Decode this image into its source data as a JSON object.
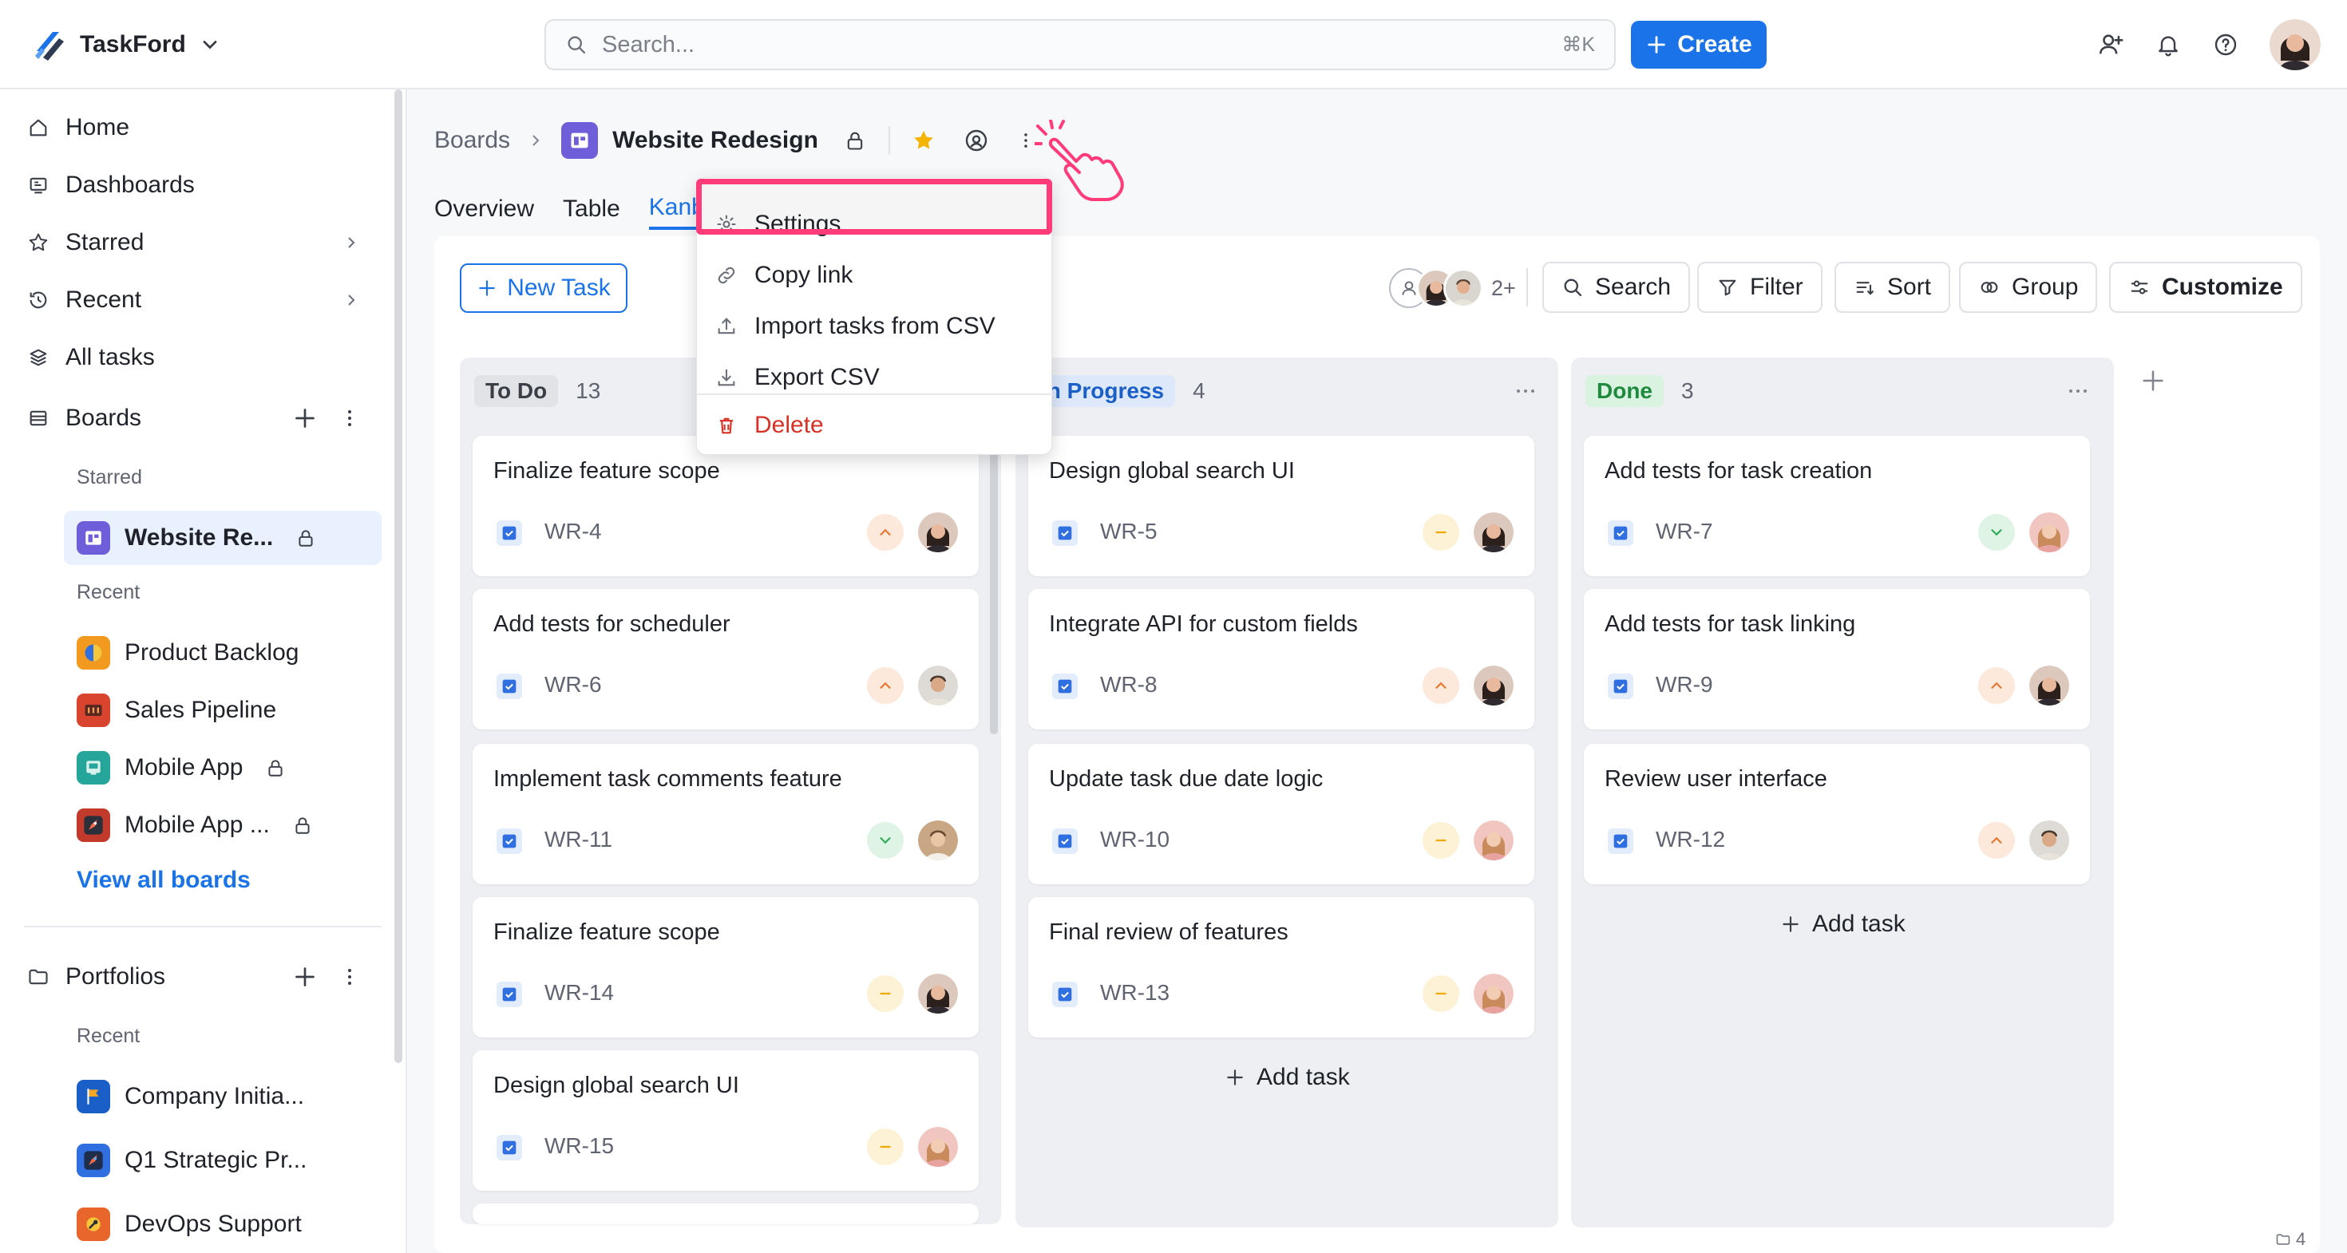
{
  "app": {
    "name": "TaskFord"
  },
  "search": {
    "placeholder": "Search...",
    "shortcut": "⌘K"
  },
  "header": {
    "create_label": "Create"
  },
  "sidebar": {
    "nav": [
      {
        "label": "Home",
        "icon": "home-icon"
      },
      {
        "label": "Dashboards",
        "icon": "dashboard-icon"
      },
      {
        "label": "Starred",
        "icon": "star-icon"
      },
      {
        "label": "Recent",
        "icon": "history-icon"
      },
      {
        "label": "All tasks",
        "icon": "layers-icon"
      }
    ],
    "boards_label": "Boards",
    "starred_label": "Starred",
    "recent_label": "Recent",
    "starred_boards": [
      {
        "label": "Website Re...",
        "locked": true
      }
    ],
    "recent_boards": [
      {
        "label": "Product Backlog",
        "locked": false
      },
      {
        "label": "Sales Pipeline",
        "locked": false
      },
      {
        "label": "Mobile App",
        "locked": true
      },
      {
        "label": "Mobile App ...",
        "locked": true
      }
    ],
    "view_all_label": "View all boards",
    "portfolios_label": "Portfolios",
    "portfolios_recent_label": "Recent",
    "portfolios": [
      {
        "label": "Company Initia..."
      },
      {
        "label": "Q1 Strategic Pr..."
      },
      {
        "label": "DevOps Support"
      }
    ]
  },
  "breadcrumb": {
    "root": "Boards",
    "title": "Website Redesign"
  },
  "tabs": [
    {
      "label": "Overview"
    },
    {
      "label": "Table"
    },
    {
      "label": "Kanban",
      "active": true
    }
  ],
  "toolbar": {
    "new_task_label": "New Task",
    "members_more": "2+",
    "search_label": "Search",
    "filter_label": "Filter",
    "sort_label": "Sort",
    "group_label": "Group",
    "customize_label": "Customize"
  },
  "menu": {
    "items": [
      {
        "label": "Settings",
        "icon": "gear-icon"
      },
      {
        "label": "Copy link",
        "icon": "link-icon"
      },
      {
        "label": "Import tasks from CSV",
        "icon": "upload-icon"
      },
      {
        "label": "Export CSV",
        "icon": "download-icon"
      }
    ],
    "delete_label": "Delete"
  },
  "columns": [
    {
      "name": "To Do",
      "count": "13",
      "tag_color": "#e2e3e7",
      "tag_text": "#3a3f47",
      "cards": [
        {
          "title": "Finalize feature scope",
          "key": "WR-4",
          "priority": "high"
        },
        {
          "title": "Add tests for scheduler",
          "key": "WR-6",
          "priority": "high"
        },
        {
          "title": "Implement task comments feature",
          "key": "WR-11",
          "priority": "low"
        },
        {
          "title": "Finalize feature scope",
          "key": "WR-14",
          "priority": "medium"
        },
        {
          "title": "Design global search UI",
          "key": "WR-15",
          "priority": "medium"
        }
      ]
    },
    {
      "name": "In Progress",
      "count": "4",
      "tag_color": "#dde8fb",
      "tag_text": "#1a5fc7",
      "cards": [
        {
          "title": "Design global search UI",
          "key": "WR-5",
          "priority": "medium"
        },
        {
          "title": "Integrate API for custom fields",
          "key": "WR-8",
          "priority": "high"
        },
        {
          "title": "Update task due date logic",
          "key": "WR-10",
          "priority": "medium"
        },
        {
          "title": "Final review of features",
          "key": "WR-13",
          "priority": "medium"
        }
      ],
      "add_task_label": "Add task"
    },
    {
      "name": "Done",
      "count": "3",
      "tag_color": "#daf2e0",
      "tag_text": "#1e8a3e",
      "cards": [
        {
          "title": "Add tests for task creation",
          "key": "WR-7",
          "priority": "low"
        },
        {
          "title": "Add tests for task linking",
          "key": "WR-9",
          "priority": "high"
        },
        {
          "title": "Review user interface",
          "key": "WR-12",
          "priority": "high"
        }
      ],
      "add_task_label": "Add task"
    }
  ],
  "footer": {
    "indicator": "4"
  },
  "colors": {
    "accent": "#1a73e8",
    "highlight": "#ff3b7a",
    "danger": "#d93025"
  }
}
